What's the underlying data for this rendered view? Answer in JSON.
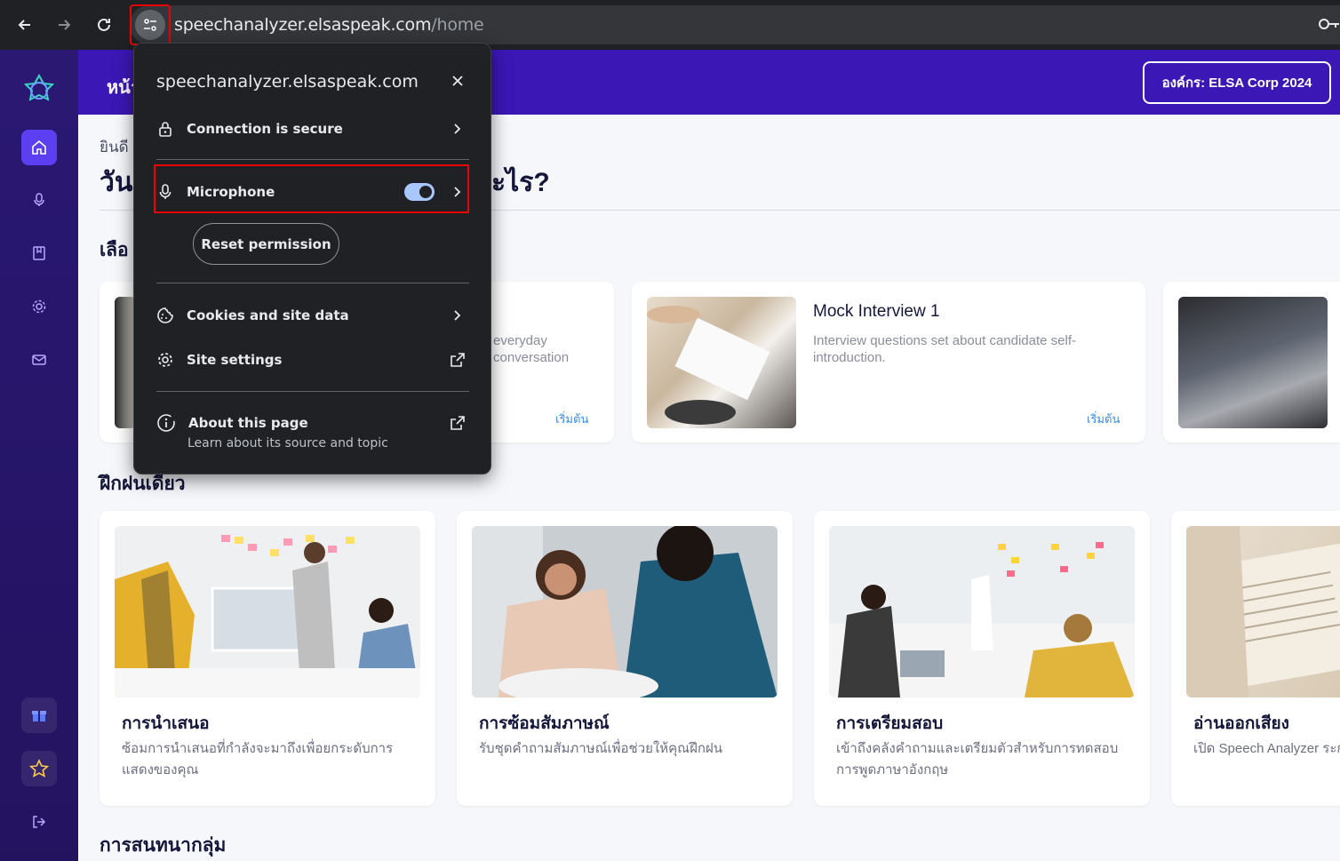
{
  "browser": {
    "url_host": "speechanalyzer.elsaspeak.com",
    "url_path": "/home"
  },
  "header": {
    "title_partial": "หน้า",
    "org_button": "องค์กร: ELSA Corp 2024"
  },
  "main": {
    "welcome_partial": "ยินดี",
    "question_left": "วัน",
    "question_right": "ะไร?",
    "choose_partial": "เลือ",
    "practice_title": "ฝึกฝนเดี่ยว",
    "group_title": "การสนทนากลุ่ม"
  },
  "top_cards": [
    {
      "desc_line1": "everyday",
      "desc_line2": "conversation",
      "start": "เริ่มต้น"
    },
    {
      "title": "Mock Interview 1",
      "desc_line1": "Interview questions set about candidate self-",
      "desc_line2": "introduction.",
      "start": "เริ่มต้น"
    }
  ],
  "practice_cards": [
    {
      "title": "การนำเสนอ",
      "desc": "ซ้อมการนำเสนอที่กำลังจะมาถึงเพื่อยกระดับการแสดงของคุณ"
    },
    {
      "title": "การซ้อมสัมภาษณ์",
      "desc": "รับชุดคำถามสัมภาษณ์เพื่อช่วยให้คุณฝึกฝน"
    },
    {
      "title": "การเตรียมสอบ",
      "desc": "เข้าถึงคลังคำถามและเตรียมตัวสำหรับการทดสอบการพูดภาษาอังกฤษ"
    },
    {
      "title": "อ่านออกเสียง",
      "desc": "เปิด Speech Analyzer ระการสนทนากับเพื่อน"
    }
  ],
  "popup": {
    "host": "speechanalyzer.elsaspeak.com",
    "connection": "Connection is secure",
    "microphone": "Microphone",
    "microphone_enabled": true,
    "reset": "Reset permission",
    "cookies": "Cookies and site data",
    "site_settings": "Site settings",
    "about": "About this page",
    "about_sub": "Learn about its source and topic"
  },
  "colors": {
    "brand_purple": "#3b17b5",
    "sidebar": "#2a1873",
    "active_nav": "#5b3ff0",
    "link": "#3b8de0"
  }
}
